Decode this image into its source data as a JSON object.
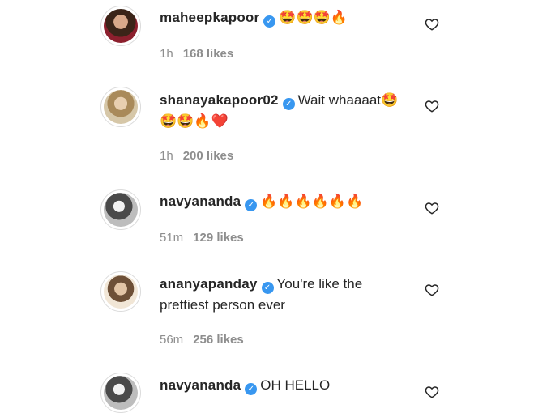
{
  "comments": [
    {
      "username": "maheepkapoor",
      "text": "🤩🤩🤩🔥",
      "time": "1h",
      "likes": "168 likes"
    },
    {
      "username": "shanayakapoor02",
      "text": "Wait whaaaat🤩🤩🤩🔥❤️",
      "time": "1h",
      "likes": "200 likes"
    },
    {
      "username": "navyananda",
      "text": "🔥🔥🔥🔥🔥🔥",
      "time": "51m",
      "likes": "129 likes"
    },
    {
      "username": "ananyapanday",
      "text": "You're like the prettiest person ever",
      "time": "56m",
      "likes": "256 likes"
    },
    {
      "username": "navyananda",
      "text": "OH HELLO",
      "time": "",
      "likes": ""
    }
  ],
  "icons": {
    "verified": "verified-badge-icon",
    "like": "heart-outline-icon"
  }
}
